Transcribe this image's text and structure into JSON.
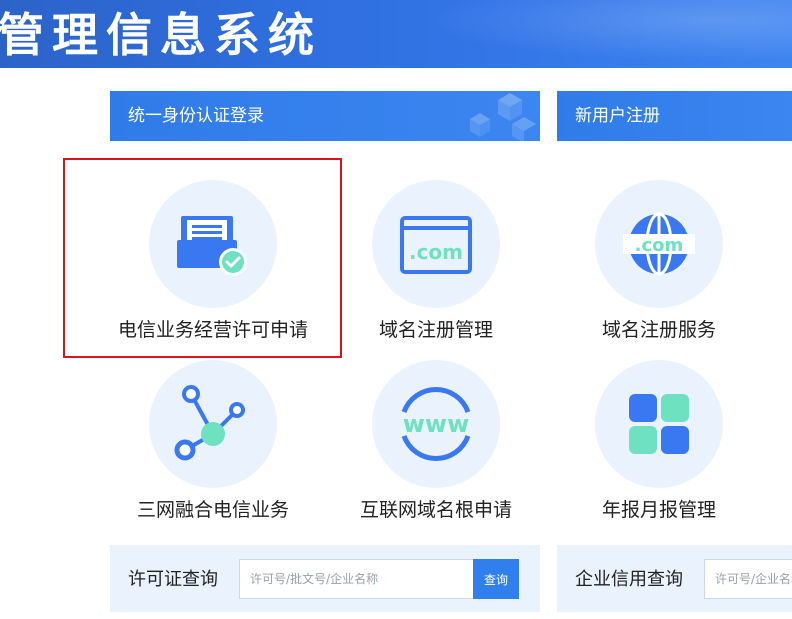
{
  "header": {
    "title": "管理信息系统"
  },
  "sections": {
    "login_label": "统一身份认证登录",
    "register_label": "新用户注册"
  },
  "services": [
    {
      "label": "电信业务经营许可申请",
      "icon": "license-doc-check-icon"
    },
    {
      "label": "域名注册管理",
      "icon": "com-browser-icon"
    },
    {
      "label": "域名注册服务",
      "icon": "com-globe-icon"
    },
    {
      "label": "三网融合电信业务",
      "icon": "network-nodes-icon"
    },
    {
      "label": "互联网域名根申请",
      "icon": "www-globe-icon"
    },
    {
      "label": "年报月报管理",
      "icon": "grid-blocks-icon"
    }
  ],
  "icon_texts": {
    "com": ".com",
    "www": "www"
  },
  "license_query": {
    "title": "许可证查询",
    "placeholder": "许可号/批文号/企业名称",
    "button": "查询"
  },
  "credit_query": {
    "title": "企业信用查询",
    "placeholder": "许可号/企业名称"
  },
  "colors": {
    "primary_blue": "#2f7be8",
    "icon_blue": "#3a78f2",
    "icon_green": "#6ee1c0",
    "tile_bg": "#eaf3fd",
    "highlight_red": "#d9141c"
  }
}
